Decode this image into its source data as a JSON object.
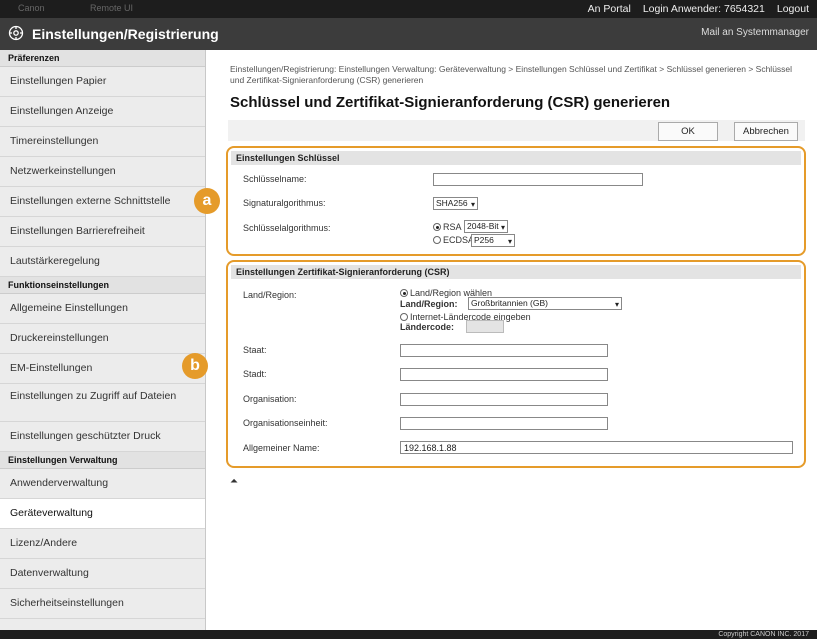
{
  "topbar": {
    "ghost_left_1": "Canon",
    "ghost_left_2": "Remote UI",
    "portal": "An Portal",
    "login_label": "Login Anwender:",
    "login_user": "7654321",
    "logout": "Logout"
  },
  "header": {
    "title": "Einstellungen/Registrierung",
    "mail": "Mail an Systemmanager"
  },
  "sidebar": {
    "sections": [
      {
        "heading": "Präferenzen",
        "items": [
          "Einstellungen Papier",
          "Einstellungen Anzeige",
          "Timereinstellungen",
          "Netzwerkeinstellungen",
          "Einstellungen externe Schnittstelle",
          "Einstellungen Barrierefreiheit",
          "Lautstärkeregelung"
        ]
      },
      {
        "heading": "Funktionseinstellungen",
        "items": [
          "Allgemeine Einstellungen",
          "Druckereinstellungen",
          "EM-Einstellungen",
          "Einstellungen zu Zugriff auf Dateien",
          "Einstellungen geschützter Druck"
        ]
      },
      {
        "heading": "Einstellungen Verwaltung",
        "items": [
          "Anwenderverwaltung",
          "Geräteverwaltung",
          "Lizenz/Andere",
          "Datenverwaltung",
          "Sicherheitseinstellungen"
        ]
      }
    ],
    "active": "Geräteverwaltung"
  },
  "breadcrumb": "Einstellungen/Registrierung: Einstellungen Verwaltung: Geräteverwaltung > Einstellungen Schlüssel und Zertifikat > Schlüssel generieren > Schlüssel und Zertifikat-Signieranforderung (CSR) generieren",
  "page_title": "Schlüssel und Zertifikat-Signieranforderung (CSR) generieren",
  "buttons": {
    "ok": "OK",
    "cancel": "Abbrechen"
  },
  "markers": {
    "a": "a",
    "b": "b"
  },
  "key_section": {
    "heading": "Einstellungen Schlüssel",
    "key_name_label": "Schlüsselname:",
    "key_name_value": "",
    "signature_label": "Signaturalgorithmus:",
    "signature_value": "SHA256",
    "keyalg_label": "Schlüsselalgorithmus:",
    "rsa_label": "RSA",
    "rsa_value": "2048-Bit",
    "ecdsa_label": "ECDSA",
    "ecdsa_value": "P256"
  },
  "csr_section": {
    "heading": "Einstellungen Zertifikat-Signieranforderung (CSR)",
    "country_label": "Land/Region:",
    "choose_country": "Land/Region wählen",
    "country_field_label": "Land/Region:",
    "country_value": "Großbritannien (GB)",
    "internet_code": "Internet-Ländercode eingeben",
    "country_code_label": "Ländercode:",
    "country_code_value": "",
    "state_label": "Staat:",
    "state_value": "",
    "city_label": "Stadt:",
    "city_value": "",
    "org_label": "Organisation:",
    "org_value": "",
    "orgunit_label": "Organisationseinheit:",
    "orgunit_value": "",
    "common_name_label": "Allgemeiner Name:",
    "common_name_value": "192.168.1.88"
  },
  "to_top": "⏶",
  "footer": "Copyright CANON INC. 2017",
  "colors": {
    "accent": "#e59b2a",
    "header": "#3c3c3c",
    "topbar": "#1d1d1d"
  }
}
